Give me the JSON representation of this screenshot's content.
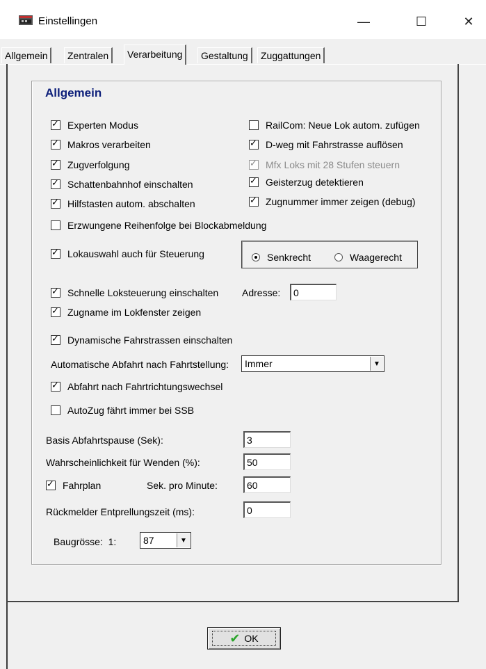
{
  "window": {
    "title": "Einstellingen",
    "app_icon": "app-window-icon",
    "controls": {
      "minimize": "—",
      "maximize": "☐",
      "close": "✕"
    }
  },
  "tabs": [
    {
      "label": "Allgemein",
      "active": false
    },
    {
      "label": "Zentralen",
      "active": false
    },
    {
      "label": "Verarbeitung",
      "active": true
    },
    {
      "label": "Gestaltung",
      "active": false
    },
    {
      "label": "Zuggattungen",
      "active": false
    }
  ],
  "group": {
    "title": "Allgemein",
    "left_checks": [
      {
        "label": "Experten Modus",
        "checked": true
      },
      {
        "label": "Makros verarbeiten",
        "checked": true
      },
      {
        "label": "Zugverfolgung",
        "checked": true
      },
      {
        "label": "Schattenbahnhof einschalten",
        "checked": true
      },
      {
        "label": "Hilfstasten autom. abschalten",
        "checked": true
      }
    ],
    "right_checks": [
      {
        "label": "RailCom: Neue Lok autom. zufügen",
        "checked": false
      },
      {
        "label": "D-weg mit Fahrstrasse auflösen",
        "checked": true
      },
      {
        "label": "Mfx Loks mit 28 Stufen steuern",
        "checked": true,
        "disabled": true
      },
      {
        "label": "Geisterzug detektieren",
        "checked": true
      },
      {
        "label": "Zugnummer immer zeigen (debug)",
        "checked": true
      }
    ],
    "forced_order": {
      "label": "Erzwungene Reihenfolge bei Blockabmeldung",
      "checked": false
    },
    "loco_select": {
      "label": "Lokauswahl auch für Steuerung",
      "checked": true
    },
    "orientation": {
      "options": [
        "Senkrecht",
        "Waagerecht"
      ],
      "selected": "Senkrecht"
    },
    "fast_control": {
      "label": "Schnelle Loksteuerung einschalten",
      "checked": true,
      "address_label": "Adresse:",
      "address_value": "0"
    },
    "train_name": {
      "label": "Zugname im Lokfenster zeigen",
      "checked": true
    },
    "dynamic_routes": {
      "label": "Dynamische Fahrstrassen einschalten",
      "checked": true
    },
    "auto_departure": {
      "label": "Automatische Abfahrt nach Fahrtstellung:",
      "value": "Immer"
    },
    "direction_change": {
      "label": "Abfahrt nach Fahrtrichtungswechsel",
      "checked": true
    },
    "autozug": {
      "label": "AutoZug fährt immer bei SSB",
      "checked": false
    },
    "base_pause": {
      "label": "Basis Abfahrtspause (Sek):",
      "value": "3"
    },
    "turn_probability": {
      "label": "Wahrscheinlichkeit für Wenden (%):",
      "value": "50"
    },
    "timetable": {
      "label": "Fahrplan",
      "checked": true,
      "secs_label": "Sek. pro Minute:",
      "secs_value": "60"
    },
    "debounce": {
      "label": "Rückmelder Entprellungszeit (ms):",
      "value": "0"
    },
    "scale": {
      "label": "Baugrösse:  1:",
      "value": "87"
    }
  },
  "ok_button": {
    "label": "OK"
  }
}
